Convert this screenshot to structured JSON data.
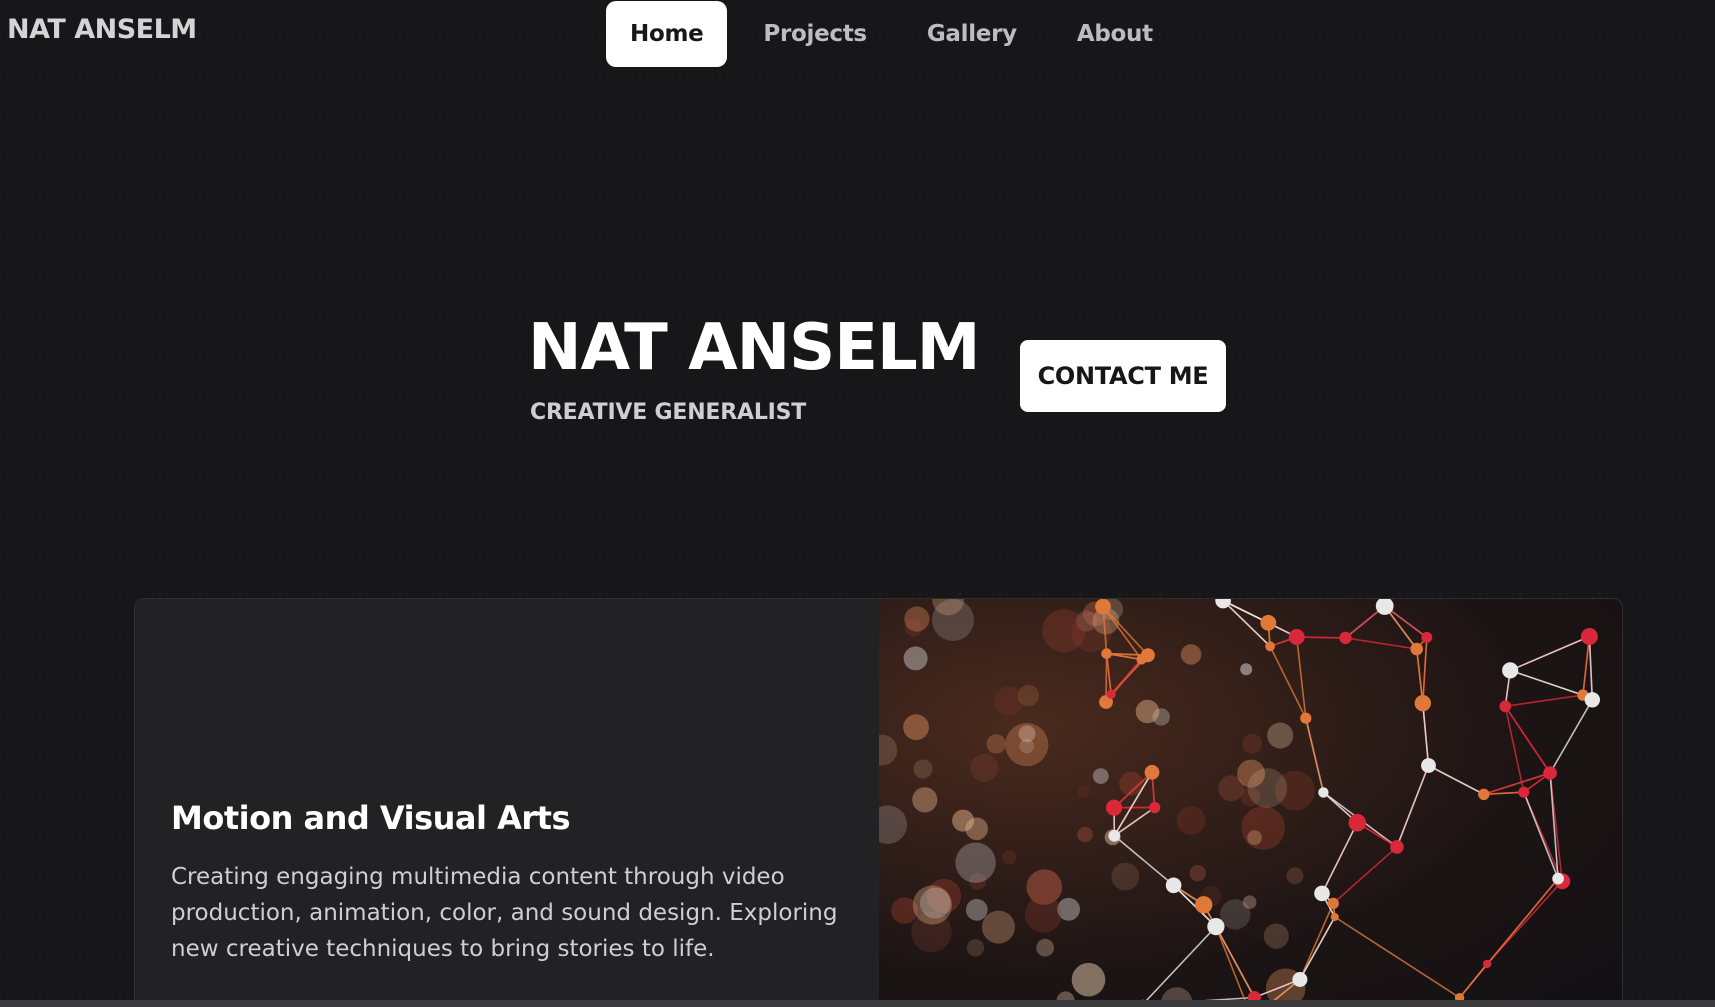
{
  "header": {
    "brand": "NAT ANSELM",
    "nav": [
      {
        "label": "Home",
        "active": true
      },
      {
        "label": "Projects",
        "active": false
      },
      {
        "label": "Gallery",
        "active": false
      },
      {
        "label": "About",
        "active": false
      }
    ]
  },
  "hero": {
    "title": "NAT ANSELM",
    "subtitle": "CREATIVE GENERALIST",
    "contact_label": "CONTACT ME"
  },
  "feature": {
    "title": "Motion and Visual Arts",
    "description": "Creating engaging multimedia content through video production, animation, color, and sound design. Exploring new creative techniques to bring stories to life.",
    "image_icon": "network-abstract-image"
  },
  "colors": {
    "background": "#17171a",
    "card": "#222224",
    "accent_orange": "#e0783a",
    "accent_red": "#d8283a",
    "node_white": "#e8e8e8"
  }
}
